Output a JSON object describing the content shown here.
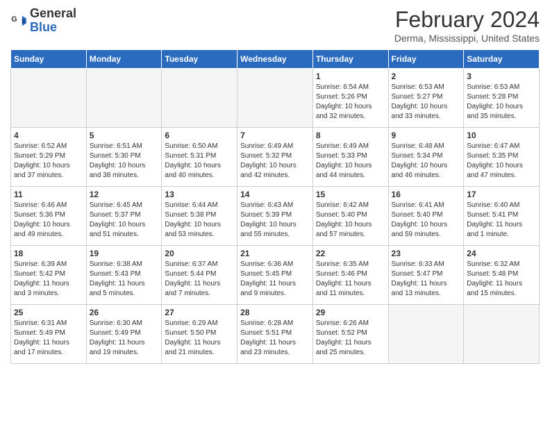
{
  "header": {
    "logo_general": "General",
    "logo_blue": "Blue",
    "month_year": "February 2024",
    "location": "Derma, Mississippi, United States"
  },
  "weekdays": [
    "Sunday",
    "Monday",
    "Tuesday",
    "Wednesday",
    "Thursday",
    "Friday",
    "Saturday"
  ],
  "weeks": [
    [
      {
        "day": "",
        "info": ""
      },
      {
        "day": "",
        "info": ""
      },
      {
        "day": "",
        "info": ""
      },
      {
        "day": "",
        "info": ""
      },
      {
        "day": "1",
        "info": "Sunrise: 6:54 AM\nSunset: 5:26 PM\nDaylight: 10 hours\nand 32 minutes."
      },
      {
        "day": "2",
        "info": "Sunrise: 6:53 AM\nSunset: 5:27 PM\nDaylight: 10 hours\nand 33 minutes."
      },
      {
        "day": "3",
        "info": "Sunrise: 6:53 AM\nSunset: 5:28 PM\nDaylight: 10 hours\nand 35 minutes."
      }
    ],
    [
      {
        "day": "4",
        "info": "Sunrise: 6:52 AM\nSunset: 5:29 PM\nDaylight: 10 hours\nand 37 minutes."
      },
      {
        "day": "5",
        "info": "Sunrise: 6:51 AM\nSunset: 5:30 PM\nDaylight: 10 hours\nand 38 minutes."
      },
      {
        "day": "6",
        "info": "Sunrise: 6:50 AM\nSunset: 5:31 PM\nDaylight: 10 hours\nand 40 minutes."
      },
      {
        "day": "7",
        "info": "Sunrise: 6:49 AM\nSunset: 5:32 PM\nDaylight: 10 hours\nand 42 minutes."
      },
      {
        "day": "8",
        "info": "Sunrise: 6:49 AM\nSunset: 5:33 PM\nDaylight: 10 hours\nand 44 minutes."
      },
      {
        "day": "9",
        "info": "Sunrise: 6:48 AM\nSunset: 5:34 PM\nDaylight: 10 hours\nand 46 minutes."
      },
      {
        "day": "10",
        "info": "Sunrise: 6:47 AM\nSunset: 5:35 PM\nDaylight: 10 hours\nand 47 minutes."
      }
    ],
    [
      {
        "day": "11",
        "info": "Sunrise: 6:46 AM\nSunset: 5:36 PM\nDaylight: 10 hours\nand 49 minutes."
      },
      {
        "day": "12",
        "info": "Sunrise: 6:45 AM\nSunset: 5:37 PM\nDaylight: 10 hours\nand 51 minutes."
      },
      {
        "day": "13",
        "info": "Sunrise: 6:44 AM\nSunset: 5:38 PM\nDaylight: 10 hours\nand 53 minutes."
      },
      {
        "day": "14",
        "info": "Sunrise: 6:43 AM\nSunset: 5:39 PM\nDaylight: 10 hours\nand 55 minutes."
      },
      {
        "day": "15",
        "info": "Sunrise: 6:42 AM\nSunset: 5:40 PM\nDaylight: 10 hours\nand 57 minutes."
      },
      {
        "day": "16",
        "info": "Sunrise: 6:41 AM\nSunset: 5:40 PM\nDaylight: 10 hours\nand 59 minutes."
      },
      {
        "day": "17",
        "info": "Sunrise: 6:40 AM\nSunset: 5:41 PM\nDaylight: 11 hours\nand 1 minute."
      }
    ],
    [
      {
        "day": "18",
        "info": "Sunrise: 6:39 AM\nSunset: 5:42 PM\nDaylight: 11 hours\nand 3 minutes."
      },
      {
        "day": "19",
        "info": "Sunrise: 6:38 AM\nSunset: 5:43 PM\nDaylight: 11 hours\nand 5 minutes."
      },
      {
        "day": "20",
        "info": "Sunrise: 6:37 AM\nSunset: 5:44 PM\nDaylight: 11 hours\nand 7 minutes."
      },
      {
        "day": "21",
        "info": "Sunrise: 6:36 AM\nSunset: 5:45 PM\nDaylight: 11 hours\nand 9 minutes."
      },
      {
        "day": "22",
        "info": "Sunrise: 6:35 AM\nSunset: 5:46 PM\nDaylight: 11 hours\nand 11 minutes."
      },
      {
        "day": "23",
        "info": "Sunrise: 6:33 AM\nSunset: 5:47 PM\nDaylight: 11 hours\nand 13 minutes."
      },
      {
        "day": "24",
        "info": "Sunrise: 6:32 AM\nSunset: 5:48 PM\nDaylight: 11 hours\nand 15 minutes."
      }
    ],
    [
      {
        "day": "25",
        "info": "Sunrise: 6:31 AM\nSunset: 5:49 PM\nDaylight: 11 hours\nand 17 minutes."
      },
      {
        "day": "26",
        "info": "Sunrise: 6:30 AM\nSunset: 5:49 PM\nDaylight: 11 hours\nand 19 minutes."
      },
      {
        "day": "27",
        "info": "Sunrise: 6:29 AM\nSunset: 5:50 PM\nDaylight: 11 hours\nand 21 minutes."
      },
      {
        "day": "28",
        "info": "Sunrise: 6:28 AM\nSunset: 5:51 PM\nDaylight: 11 hours\nand 23 minutes."
      },
      {
        "day": "29",
        "info": "Sunrise: 6:26 AM\nSunset: 5:52 PM\nDaylight: 11 hours\nand 25 minutes."
      },
      {
        "day": "",
        "info": ""
      },
      {
        "day": "",
        "info": ""
      }
    ]
  ]
}
